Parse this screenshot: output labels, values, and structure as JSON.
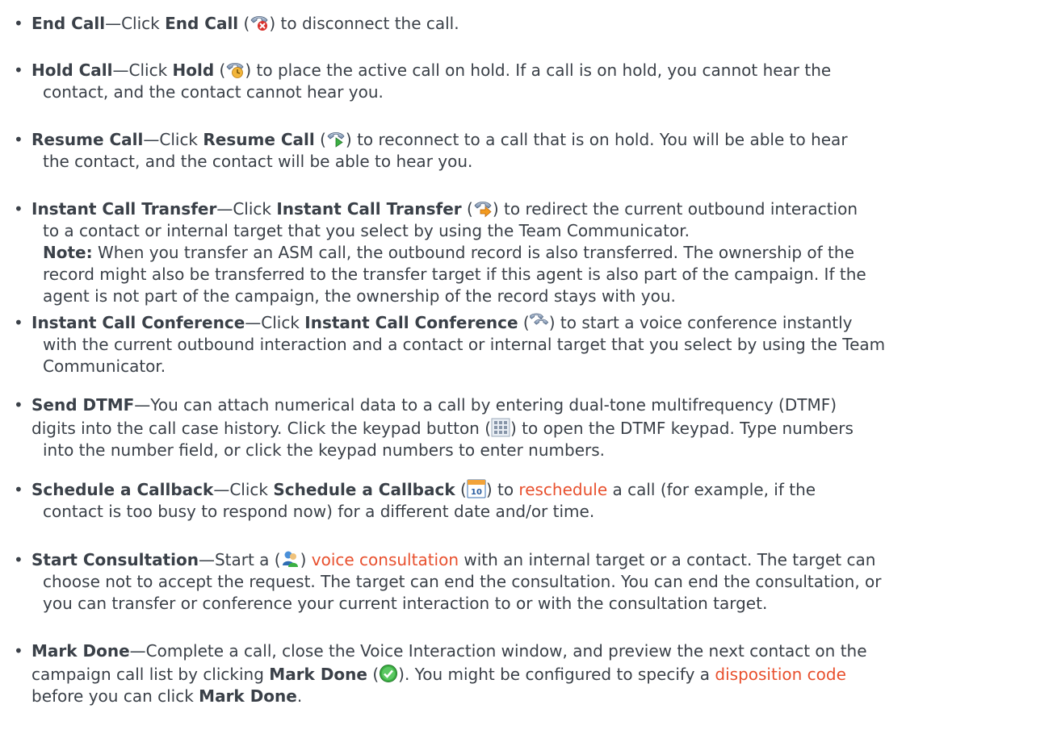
{
  "items": [
    {
      "term": "End Call",
      "l1": {
        "a": "—Click ",
        "b": "End Call",
        "c": " (",
        "d": ") to disconnect the call."
      }
    },
    {
      "term": "Hold Call",
      "l1": {
        "a": "—Click ",
        "b": "Hold",
        "c": " (",
        "d": ") to place the active call on hold. If a call is on hold, you cannot hear the"
      },
      "l2": "contact, and the contact cannot hear you."
    },
    {
      "term": "Resume Call",
      "l1": {
        "a": "—Click ",
        "b": "Resume Call",
        "c": " (",
        "d": ") to reconnect to a call that is on hold. You will be able to hear"
      },
      "l2": "the contact, and the contact will be able to hear you."
    },
    {
      "term": "Instant Call Transfer",
      "l1": {
        "a": "—Click ",
        "b": "Instant Call Transfer",
        "c": " (",
        "d": ") to redirect the current outbound interaction"
      },
      "l2": "to a contact or internal target that you select by using the Team Communicator.",
      "note_label": "Note:",
      "note_text": " When you transfer an ASM call, the outbound record is also transferred. The ownership of the",
      "l4": "record might also be transferred to the transfer target if this agent is also part of the campaign. If the",
      "l5": "agent is not part of the campaign, the ownership of the record stays with you."
    },
    {
      "term": "Instant Call Conference",
      "l1": {
        "a": "—Click ",
        "b": "Instant Call Conference",
        "c": " (",
        "d": ") to start a voice conference instantly"
      },
      "l2": "with the current outbound interaction and a contact or internal target that you select by using the Team",
      "l3": "Communicator."
    },
    {
      "term": "Send DTMF",
      "l1": "—You can attach numerical data to a call by entering dual-tone multifrequency (DTMF)",
      "l2a": "digits into the call case history. Click the keypad button (",
      "l2b": ") to open the DTMF keypad. Type numbers",
      "l3": "into the number field, or click the keypad numbers to enter numbers."
    },
    {
      "term": "Schedule a Callback",
      "l1": {
        "a": "—Click ",
        "b": "Schedule a Callback",
        "c": " (",
        "d": ") to ",
        "link": "reschedule",
        "e": " a call (for example, if the"
      },
      "l2": "contact is too busy to respond now) for a different date and/or time."
    },
    {
      "term": "Start Consultation",
      "l1": {
        "a": "—Start a (",
        "b": ") ",
        "link": "voice consultation",
        "c": " with an internal target or a contact. The target can"
      },
      "l2": "choose not to accept the request. The target can end the consultation. You can end the consultation, or",
      "l3": "you can transfer or conference your current interaction to or with the consultation target."
    },
    {
      "term": "Mark Done",
      "l1": "—Complete a call, close the Voice Interaction window, and preview the next contact on the",
      "l2": {
        "a": "campaign call list by clicking ",
        "b": "Mark Done",
        "c": " (",
        "d": "). You might be configured to specify a ",
        "link": "disposition code"
      },
      "l3": {
        "a": "before you can click ",
        "b": "Mark Done",
        "c": "."
      }
    }
  ],
  "icons": [
    "end-call-icon",
    "hold-icon",
    "resume-icon",
    "transfer-icon",
    "conference-icon",
    "keypad-icon",
    "calendar-icon",
    "consult-icon",
    "mark-done-icon"
  ],
  "colors": {
    "text": "#3a4048",
    "link": "#e8502e",
    "check": "#3cb043"
  },
  "calendar_day": "10"
}
